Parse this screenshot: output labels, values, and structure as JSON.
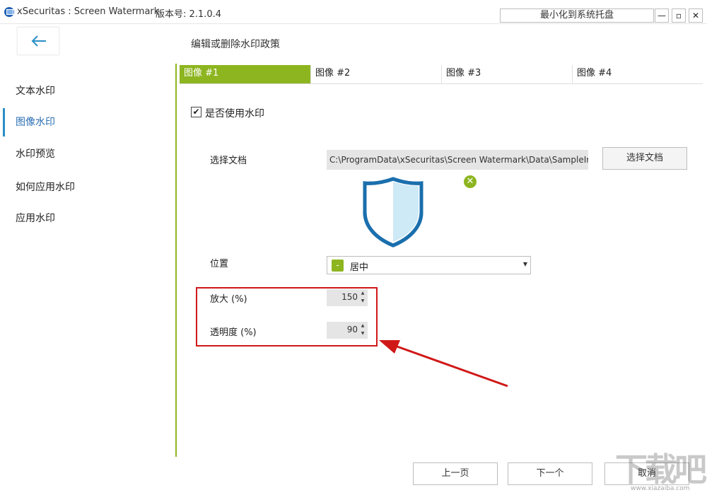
{
  "window": {
    "title": "xSecuritas : Screen Watermark",
    "version": "版本号: 2.1.0.4",
    "tray_button": "最小化到系统托盘",
    "min_glyph": "—",
    "max_glyph": "▫",
    "close_glyph": "✕"
  },
  "header": {
    "back_icon": "arrow-left-icon",
    "title": "编辑或删除水印政策"
  },
  "sidebar": {
    "items": [
      {
        "label": "文本水印"
      },
      {
        "label": "图像水印"
      },
      {
        "label": "水印预览"
      },
      {
        "label": "如何应用水印"
      },
      {
        "label": "应用水印"
      }
    ],
    "active_index": 1
  },
  "tabs": [
    {
      "label": "图像 #1"
    },
    {
      "label": "图像 #2"
    },
    {
      "label": "图像 #3"
    },
    {
      "label": "图像 #4"
    }
  ],
  "form": {
    "use_watermark": {
      "checked": true,
      "glyph": "✔",
      "label": "是否使用水印"
    },
    "select_doc": {
      "label": "选择文档",
      "path": "C:\\ProgramData\\xSecuritas\\Screen Watermark\\Data\\SampleIm",
      "button": "选择文档",
      "preview_icon": "shield-icon",
      "remove_icon_glyph": "✕"
    },
    "position": {
      "label": "位置",
      "marker": "-",
      "value": "居中",
      "caret": "▼"
    },
    "zoom": {
      "label": "放大 (%)",
      "value": "150"
    },
    "opacity": {
      "label": "透明度 (%)",
      "value": "90"
    },
    "spin_up": "▲",
    "spin_down": "▼"
  },
  "footer": {
    "prev": "上一页",
    "next": "下一个",
    "cancel": "取消"
  },
  "watermark": {
    "big": "下载吧",
    "small": "www.xiazaiba.com"
  },
  "colors": {
    "accent_green": "#8db520",
    "highlight_red": "#d01818",
    "shield_blue": "#1a6fad",
    "shield_fill": "#cdeaf6"
  }
}
